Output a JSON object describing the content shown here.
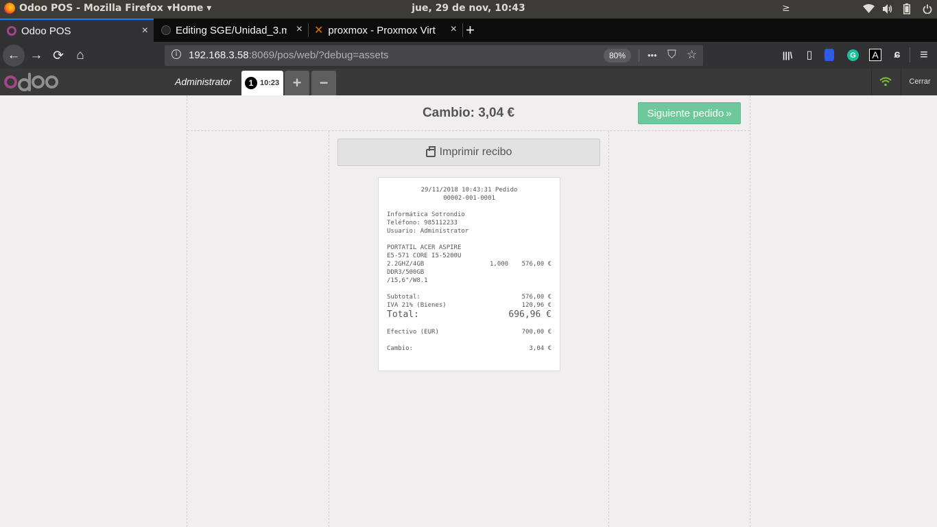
{
  "os_panel": {
    "app_name": "Odoo POS - Mozilla Firefox",
    "app_menu_arrow": "▾",
    "home_label": "Home",
    "home_arrow": "▾",
    "clock": "jue, 29 de nov, 10:43",
    "terminal_icon": "≥",
    "wifi_icon": "wifi-icon",
    "volume_icon": "volume-icon",
    "battery_icon": "battery-icon",
    "power_icon": "power-icon"
  },
  "browser": {
    "tabs": [
      {
        "title": "Odoo POS",
        "close": "×",
        "active": true
      },
      {
        "title": "Editing SGE/Unidad_3.m",
        "close": "×",
        "active": false
      },
      {
        "title": "proxmox - Proxmox Virt",
        "close": "×",
        "active": false
      }
    ],
    "new_tab": "+",
    "proxmox_favicon": "✕",
    "info_icon": "i",
    "url_host": "192.168.3.58",
    "url_path": ":8069/pos/web/?debug=assets",
    "zoom": "80%",
    "more_actions": "•••",
    "pocket_icon": "⛉",
    "star_icon": "☆",
    "back_icon": "←",
    "forward_icon": "→",
    "reload_icon": "⟳",
    "home_icon": "⌂",
    "library_icon": "|||\\",
    "sidebar_icon": "▯",
    "lock_ext_icon": "🔒",
    "grammarly_icon": "G",
    "font_ext_icon": "A",
    "gnome_ext_icon": "ɕ",
    "menu_icon": "≡"
  },
  "pos_header": {
    "user": "Administrator",
    "order_number": "1",
    "order_time": "10:23",
    "add_order": "+",
    "remove_order": "−",
    "close_label": "Cerrar"
  },
  "receipt_screen": {
    "change_title": "Cambio: 3,04 €",
    "next_order_label": "Siguiente pedido",
    "next_icon": "»",
    "print_label": "Imprimir recibo"
  },
  "receipt": {
    "header_line1": "29/11/2018 10:43:31 Pedido",
    "header_line2": "00002-001-0001",
    "company": "Informática Sotrondio",
    "phone": "Teléfono: 985112233",
    "user": "Usuario: Administrator",
    "line_desc": [
      "PORTATIL ACER ASPIRE",
      "E5-571 CORE I5-5200U",
      "2.2GHZ/4GB",
      "DDR3/500GB",
      "/15,6\"/W8.1"
    ],
    "line_qty": "1,000",
    "line_price": "576,00 €",
    "subtotal_label": "Subtotal:",
    "subtotal_value": "576,00 €",
    "tax_label": "IVA 21% (Bienes)",
    "tax_value": "120,96 €",
    "total_label": "Total:",
    "total_value": "696,96 €",
    "payment_label": "Efectivo (EUR)",
    "payment_value": "700,00 €",
    "change_label": "Cambio:",
    "change_value": "3,04 €"
  }
}
